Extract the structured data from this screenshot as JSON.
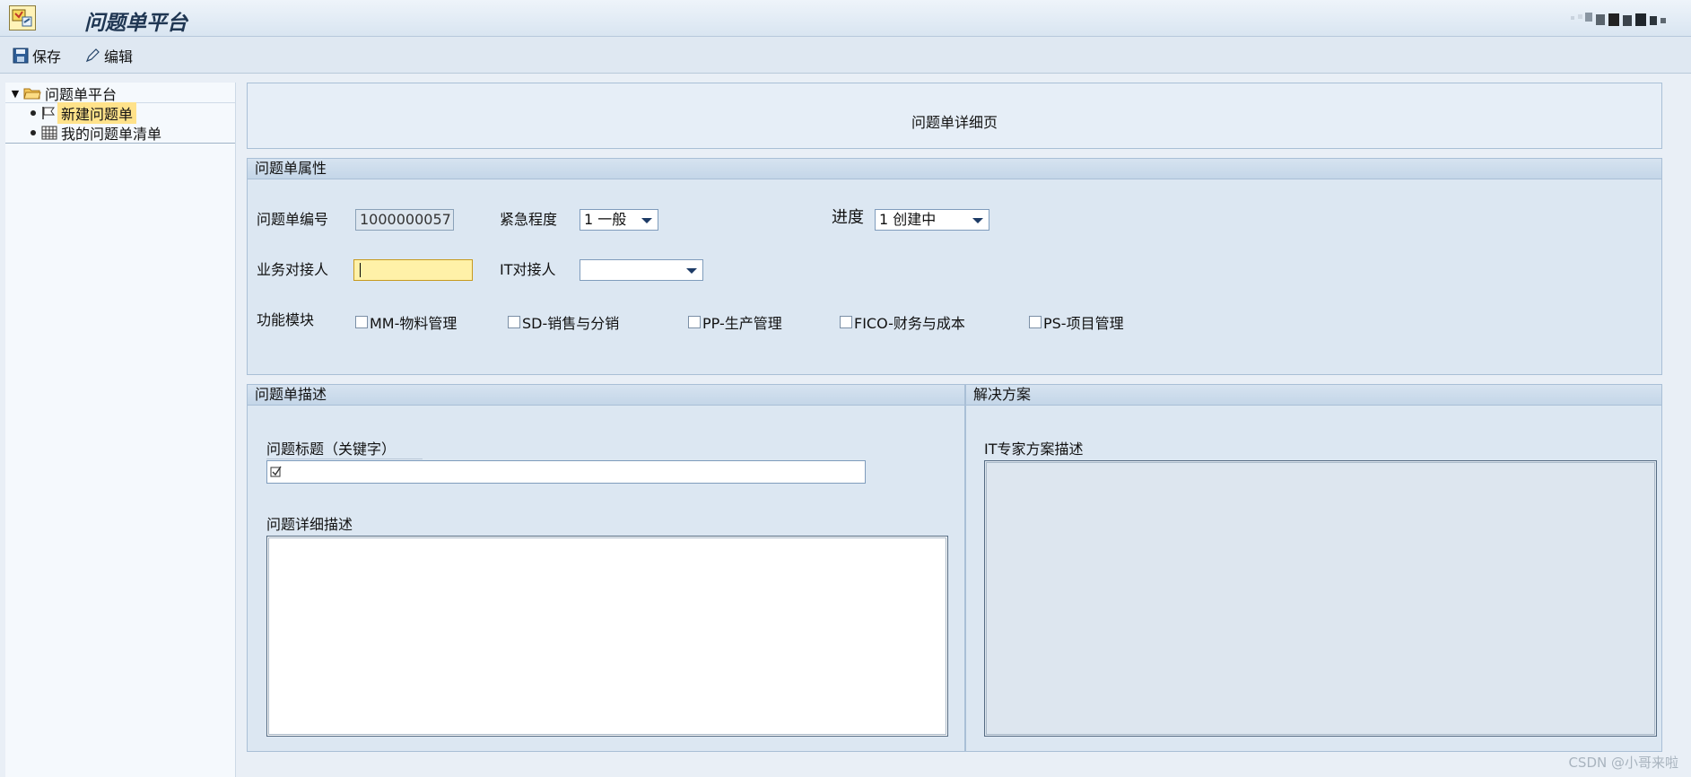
{
  "window": {
    "title": "问题单平台"
  },
  "toolbar": {
    "save_label": "保存",
    "edit_label": "编辑"
  },
  "tree": {
    "root_label": "问题单平台",
    "items": [
      {
        "label": "新建问题单"
      },
      {
        "label": "我的问题单清单"
      }
    ]
  },
  "detail": {
    "title": "问题单详细页"
  },
  "attributes": {
    "section_title": "问题单属性",
    "ticket_no_label": "问题单编号",
    "ticket_no_value": "1000000057",
    "urgency_label": "紧急程度",
    "urgency_value": "1 一般",
    "progress_label": "进度",
    "progress_value": "1 创建中",
    "biz_contact_label": "业务对接人",
    "biz_contact_value": "",
    "it_contact_label": "IT对接人",
    "it_contact_value": "",
    "module_label": "功能模块",
    "modules": [
      {
        "label": "MM-物料管理",
        "checked": false
      },
      {
        "label": "SD-销售与分销",
        "checked": false
      },
      {
        "label": "PP-生产管理",
        "checked": false
      },
      {
        "label": "FICO-财务与成本",
        "checked": false
      },
      {
        "label": "PS-项目管理",
        "checked": false
      }
    ]
  },
  "description": {
    "section_title": "问题单描述",
    "title_label": "问题标题（关键字）",
    "title_value": "",
    "detail_label": "问题详细描述",
    "detail_value": ""
  },
  "solution": {
    "section_title": "解决方案",
    "it_desc_label": "IT专家方案描述",
    "it_desc_value": ""
  },
  "watermark": "CSDN @小哥来啦"
}
